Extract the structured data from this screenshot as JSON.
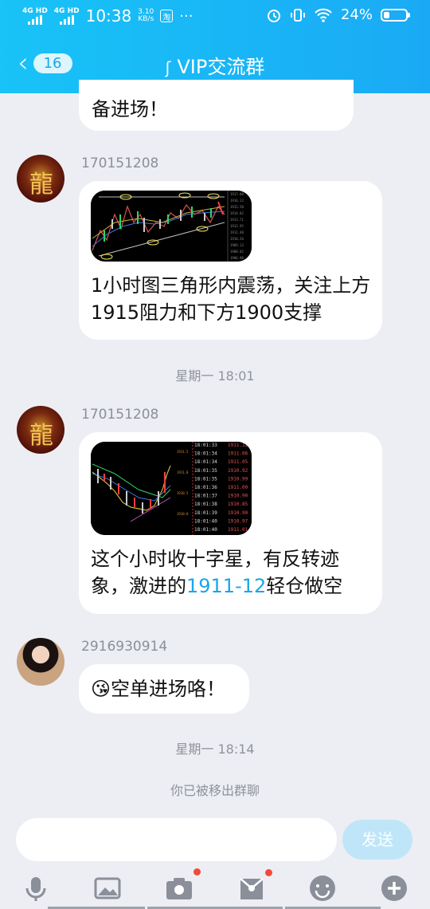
{
  "status": {
    "net1": "4G HD",
    "net2": "4G HD",
    "time": "10:38",
    "speed_value": "3.10",
    "speed_unit": "KB/s",
    "taobao": "淘",
    "more": "···",
    "battery": "24%"
  },
  "header": {
    "back_count": "16",
    "title": "VIP交流群"
  },
  "messages": [
    {
      "text": "备进场！"
    },
    {
      "user": "170151208",
      "text": "1小时图三角形内震荡，关注上方1915阻力和下方1900支撑"
    },
    {
      "user": "170151208",
      "text_pre": "这个小时收十字星，有反转迹象，激进的",
      "link": "1911-12",
      "text_post": "轻仓做空"
    },
    {
      "user": "2916930914",
      "emoji": "😘",
      "text": "空单进场咯！"
    }
  ],
  "timestamps": [
    "星期一 18:01",
    "星期一 18:14"
  ],
  "system_notice": "你已被移出群聊",
  "composer": {
    "send_label": "发送"
  },
  "chart2_ticks": [
    [
      "18:01:33",
      "1911.12"
    ],
    [
      "18:01:34",
      "1911.06"
    ],
    [
      "18:01:34",
      "1911.05"
    ],
    [
      "18:01:35",
      "1910.92"
    ],
    [
      "18:01:35",
      "1910.99"
    ],
    [
      "18:01:36",
      "1911.00"
    ],
    [
      "18:01:37",
      "1910.90"
    ],
    [
      "18:01:38",
      "1910.85"
    ],
    [
      "18:01:39",
      "1910.90"
    ],
    [
      "18:01:40",
      "1910.97"
    ],
    [
      "18:01:40",
      "1911.01"
    ]
  ],
  "colors": {
    "brand": "#1aaaf5",
    "link": "#1aa6e8",
    "badge_dot": "#f04a3a"
  },
  "toolbar_icons": [
    "mic-icon",
    "image-icon",
    "camera-icon",
    "red-packet-icon",
    "emoji-icon",
    "plus-icon"
  ]
}
